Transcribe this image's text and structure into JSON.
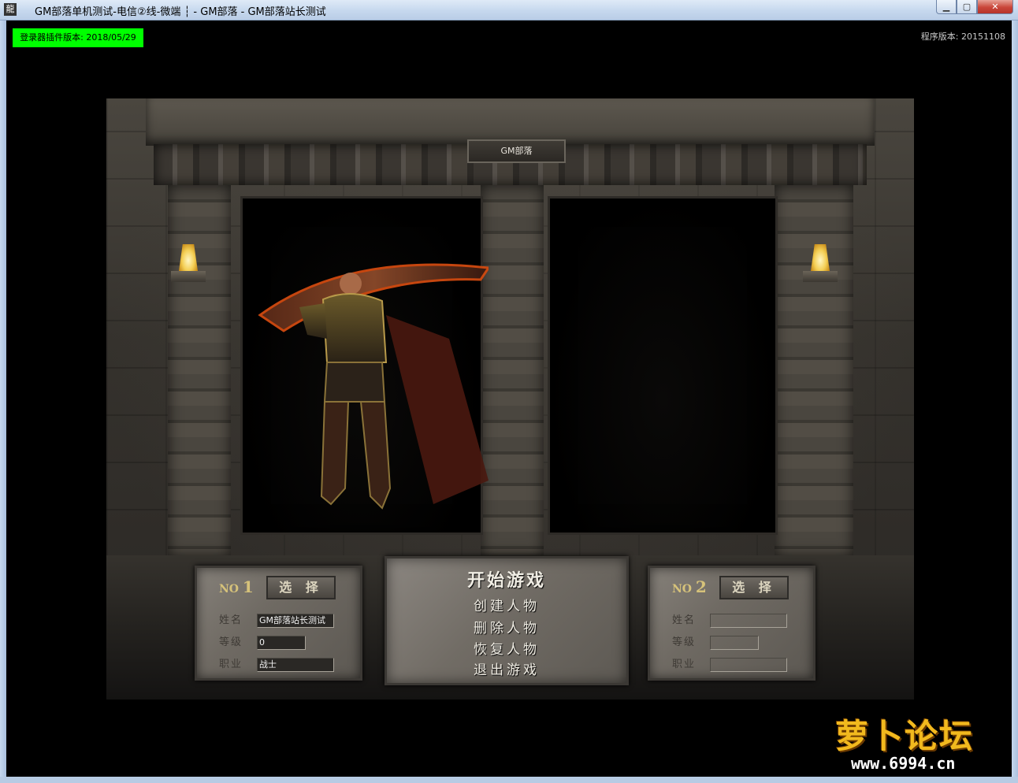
{
  "window": {
    "title": "GM部落单机测试-电信②线-微端 ┆ - GM部落 - GM部落站长测试",
    "controls": [
      "minimize",
      "maximize",
      "close"
    ]
  },
  "overlay": {
    "launcher_badge": "登录器插件版本: 2018/05/29",
    "program_version": "程序版本: 20151108",
    "badge_color": "#00ff00"
  },
  "scene": {
    "server_name": "GM部落"
  },
  "slots": [
    {
      "no_label": "NO",
      "no_number": "1",
      "select_label": "选 择",
      "fields": [
        {
          "label": "姓名",
          "value": "GM部落站长测试"
        },
        {
          "label": "等级",
          "value": "0"
        },
        {
          "label": "职业",
          "value": "战士"
        }
      ]
    },
    {
      "no_label": "NO",
      "no_number": "2",
      "select_label": "选 择",
      "fields": [
        {
          "label": "姓名",
          "value": ""
        },
        {
          "label": "等级",
          "value": ""
        },
        {
          "label": "职业",
          "value": ""
        }
      ]
    }
  ],
  "menu": {
    "start": "开始游戏",
    "create": "创建人物",
    "delete": "删除人物",
    "restore": "恢复人物",
    "exit": "退出游戏"
  },
  "watermark": {
    "title": "萝卜论坛",
    "url": "www.6994.cn"
  },
  "icons": {
    "app": "app-icon",
    "torch": "torch-icon"
  }
}
